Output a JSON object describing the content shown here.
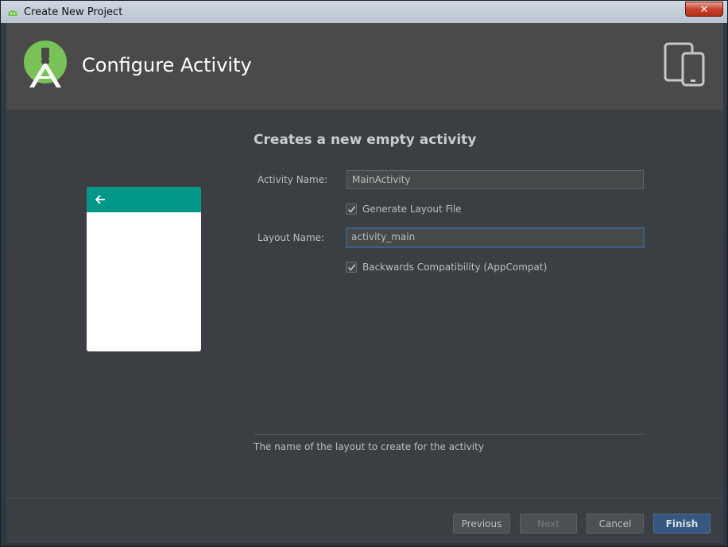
{
  "window": {
    "title": "Create New Project",
    "close_label": "✕"
  },
  "header": {
    "title": "Configure Activity"
  },
  "main": {
    "section_title": "Creates a new empty activity",
    "activity_name_label": "Activity Name:",
    "activity_name_value": "MainActivity",
    "generate_layout_label": "Generate Layout File",
    "generate_layout_checked": true,
    "layout_name_label": "Layout Name:",
    "layout_name_value": "activity_main",
    "backwards_compat_label": "Backwards Compatibility (AppCompat)",
    "backwards_compat_checked": true,
    "help_text": "The name of the layout to create for the activity"
  },
  "footer": {
    "previous_label": "Previous",
    "next_label": "Next",
    "cancel_label": "Cancel",
    "finish_label": "Finish"
  },
  "colors": {
    "accent": "#365880",
    "preview_toolbar": "#009688",
    "android_green": "#78c257"
  },
  "icons": {
    "app": "android-studio-icon",
    "logo": "android-studio-logo",
    "devices": "phone-tablet-icon",
    "back": "arrow-back-icon",
    "check": "checkmark-icon"
  }
}
